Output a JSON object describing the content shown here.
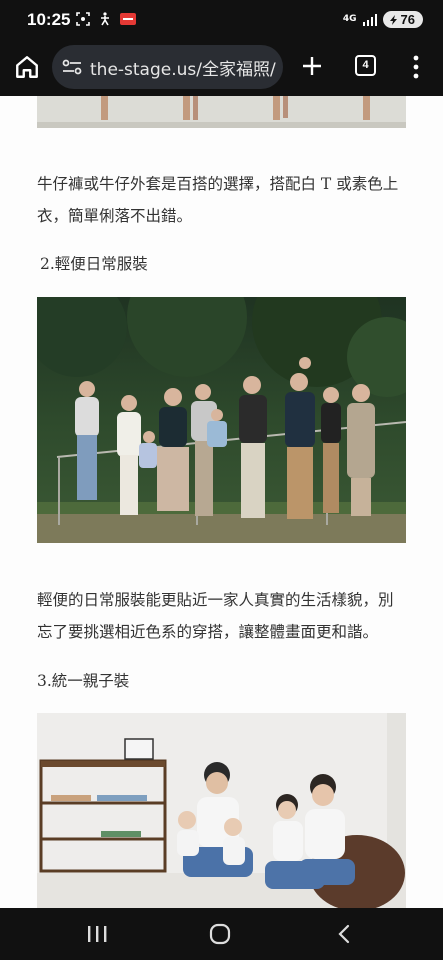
{
  "status_bar": {
    "time": "10:25",
    "network": "4G",
    "battery": "76",
    "icons": [
      "screenshot-icon",
      "accessibility-icon",
      "hdr-badge-icon",
      "signal-icon",
      "battery-icon"
    ]
  },
  "browser": {
    "url": "the-stage.us/全家福照/",
    "tab_count": "4",
    "icons": [
      "home-icon",
      "site-settings-icon",
      "new-tab-icon",
      "tab-switcher-icon",
      "more-menu-icon"
    ]
  },
  "article": {
    "paragraph_1": "牛仔褲或牛仔外套是百搭的選擇，搭配白 T 或素色上衣，簡單俐落不出錯。",
    "heading_2": "2.輕便日常服裝",
    "paragraph_2": "輕便的日常服裝能更貼近一家人真實的生活樣貌，別忘了要挑選相近色系的穿搭，讓整體畫面更和諧。",
    "heading_3": "3.統一親子裝"
  },
  "nav_bar": {
    "icons": [
      "recent-apps-icon",
      "home-circle-icon",
      "back-icon"
    ]
  }
}
